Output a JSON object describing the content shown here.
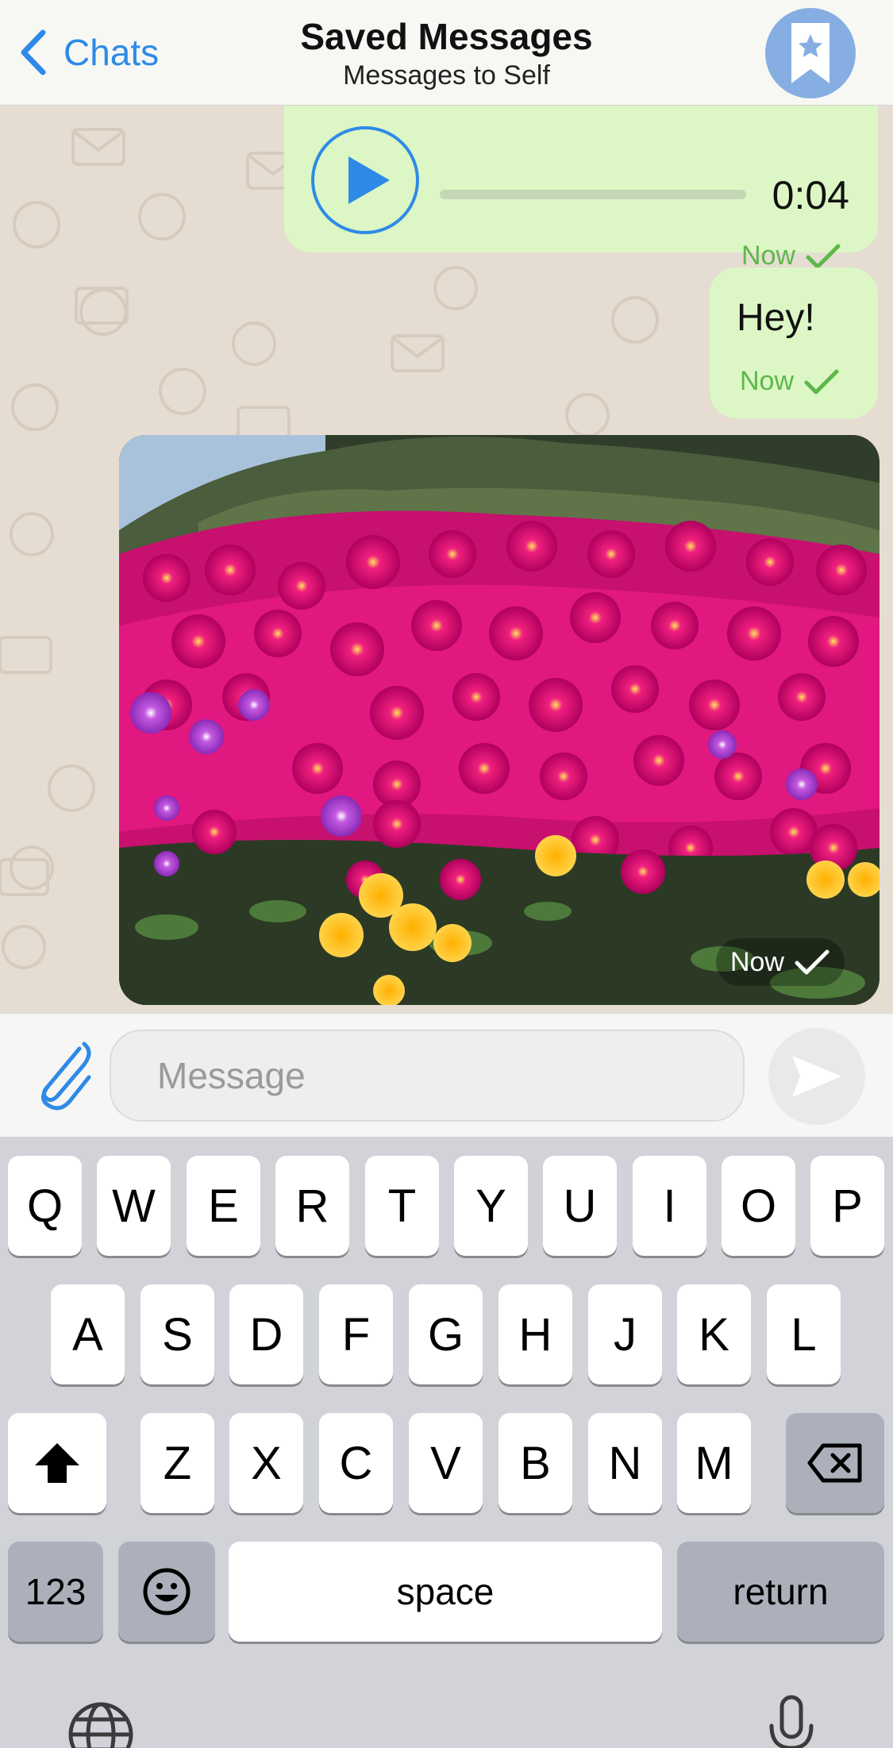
{
  "header": {
    "back_label": "Chats",
    "title": "Saved Messages",
    "subtitle": "Messages to Self",
    "avatar_icon": "bookmark-star-icon"
  },
  "messages": [
    {
      "type": "voice",
      "duration": "0:04",
      "time": "Now",
      "status": "read-check"
    },
    {
      "type": "text",
      "text": "Hey!",
      "time": "Now",
      "status": "read-check"
    },
    {
      "type": "photo",
      "description_icon": "flower-photo",
      "time": "Now",
      "status": "read-check"
    }
  ],
  "input": {
    "placeholder": "Message",
    "value": "",
    "attach_icon": "paperclip-icon",
    "send_icon": "send-arrow-icon"
  },
  "keyboard": {
    "row1": [
      "Q",
      "W",
      "E",
      "R",
      "T",
      "Y",
      "U",
      "I",
      "O",
      "P"
    ],
    "row2": [
      "A",
      "S",
      "D",
      "F",
      "G",
      "H",
      "J",
      "K",
      "L"
    ],
    "row3": [
      "Z",
      "X",
      "C",
      "V",
      "B",
      "N",
      "M"
    ],
    "shift_icon": "shift-icon",
    "delete_icon": "delete-icon",
    "numbers_label": "123",
    "emoji_icon": "emoji-icon",
    "space_label": "space",
    "return_label": "return",
    "globe_icon": "globe-icon",
    "mic_icon": "microphone-icon"
  },
  "colors": {
    "accent": "#2d8ae8",
    "bubble": "#dcf7c5",
    "check": "#5cb848",
    "chat_bg": "#e6ddd2",
    "keyboard_bg": "#d1d3d9"
  }
}
